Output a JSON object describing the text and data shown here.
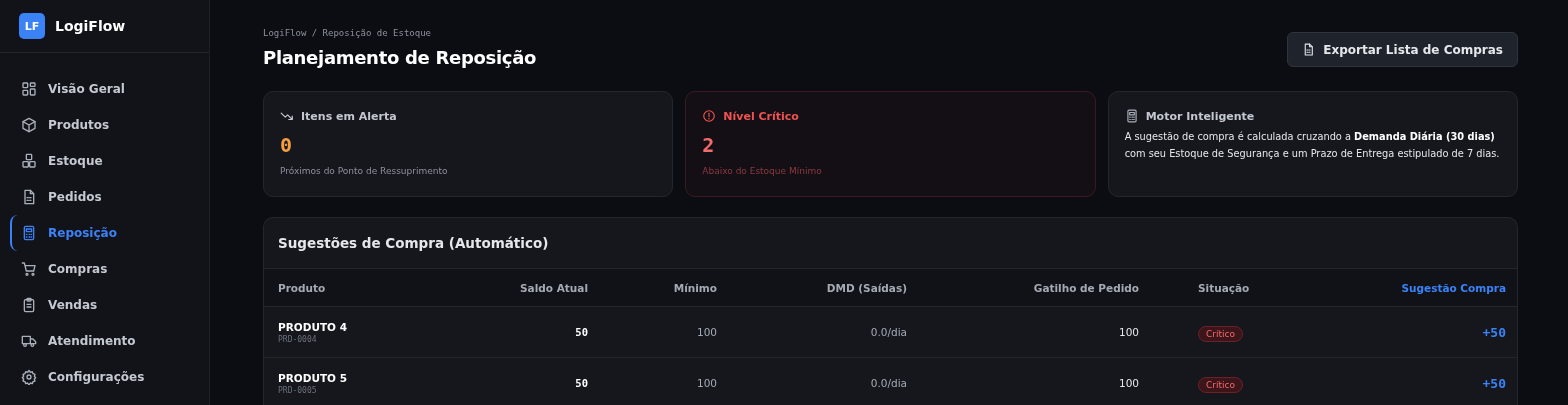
{
  "app": {
    "logo": "LF",
    "name": "LogiFlow"
  },
  "sidebar": {
    "items": [
      {
        "label": "Visão Geral",
        "selected": false
      },
      {
        "label": "Produtos",
        "selected": false
      },
      {
        "label": "Estoque",
        "selected": false
      },
      {
        "label": "Pedidos",
        "selected": false
      },
      {
        "label": "Reposição",
        "selected": true
      },
      {
        "label": "Compras",
        "selected": false
      },
      {
        "label": "Vendas",
        "selected": false
      },
      {
        "label": "Atendimento",
        "selected": false
      },
      {
        "label": "Configurações",
        "selected": false
      }
    ]
  },
  "header": {
    "breadcrumb": "LogiFlow / Reposição de Estoque",
    "title": "Planejamento de Reposição",
    "export_button": "Exportar Lista de Compras"
  },
  "cards": [
    {
      "kind": "alert",
      "title": "Itens em Alerta",
      "value": "0",
      "caption": "Próximos do Ponto de Ressuprimento"
    },
    {
      "kind": "critical",
      "title": "Nível Crítico",
      "value": "2",
      "caption": "Abaixo do Estoque Mínimo"
    },
    {
      "kind": "info",
      "title": "Motor Inteligente",
      "text": "A sugestão de compra é calculada cruzando a **Demanda Diária (30 dias)** com seu Estoque de Segurança e um Prazo de Entrega estipulado de 7 dias."
    }
  ],
  "table": {
    "title": "Sugestões de Compra (Automático)",
    "columns": [
      "Produto",
      "Saldo Atual",
      "Mínimo",
      "DMD (Saídas)",
      "Gatilho de Pedido",
      "Situação",
      "Sugestão Compra"
    ],
    "rows": [
      {
        "name": "PRODUTO 4",
        "code": "PRD-0004",
        "saldo": "50",
        "minimo": "100",
        "dmd": "0.0/dia",
        "gatilho": "100",
        "status": {
          "label": "Crítico",
          "kind": "critical"
        },
        "sugestao": "+50"
      },
      {
        "name": "PRODUTO 5",
        "code": "PRD-0005",
        "saldo": "50",
        "minimo": "100",
        "dmd": "0.0/dia",
        "gatilho": "100",
        "status": {
          "label": "Crítico",
          "kind": "critical"
        },
        "sugestao": "+50"
      }
    ]
  }
}
